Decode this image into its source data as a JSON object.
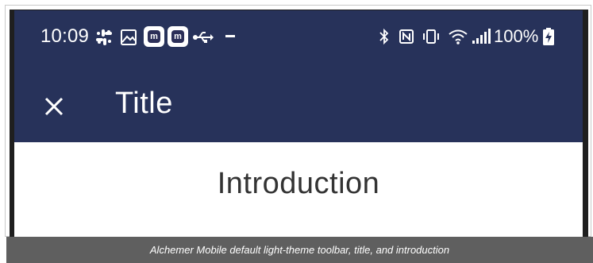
{
  "status_bar": {
    "time": "10:09",
    "battery_percent": "100%",
    "left_icons": [
      "slack-icon",
      "image-icon",
      "alchemer-notification-icon",
      "alchemer-notification-icon",
      "usb-icon",
      "more-dots-icon"
    ],
    "right_icons": [
      "bluetooth-icon",
      "nfc-icon",
      "vibrate-icon",
      "wifi-icon",
      "signal-icon",
      "battery-charging-icon"
    ],
    "notification_letter": "m"
  },
  "toolbar": {
    "close_icon": "close-icon",
    "title": "Title",
    "background_color": "#27325a"
  },
  "content": {
    "heading": "Introduction"
  },
  "caption": {
    "text": "Alchemer Mobile default light-theme toolbar, title, and introduction"
  }
}
